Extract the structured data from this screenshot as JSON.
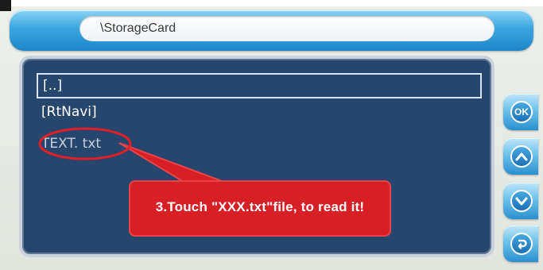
{
  "path_bar": {
    "path": "\\StorageCard"
  },
  "files": [
    {
      "label": "[..]"
    },
    {
      "label": "[RtNavi]"
    },
    {
      "label": "TEXT. txt"
    }
  ],
  "callout": {
    "text": "3.Touch \"XXX.txt\"file, to read it!"
  },
  "buttons": {
    "ok": "OK"
  },
  "icons": {
    "up": "chevron-up-icon",
    "down": "chevron-down-icon",
    "back": "back-arrow-icon"
  },
  "colors": {
    "panel": "#27466e",
    "accent": "#2a8fcf",
    "callout": "#d71f26"
  }
}
